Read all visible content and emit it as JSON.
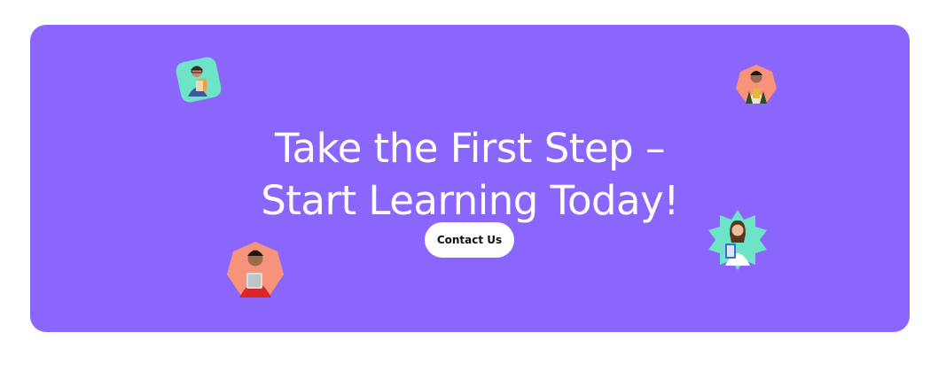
{
  "banner": {
    "headline_line1": "Take the First Step –",
    "headline_line2": "Start Learning Today!",
    "cta_label": "Contact Us"
  },
  "colors": {
    "banner_bg": "#8b66fc",
    "text": "#ffffff",
    "mint": "#6fe3c6",
    "peach": "#f7937a",
    "cta_bg": "#ffffff",
    "cta_text": "#111111"
  },
  "avatars": [
    {
      "name": "student-with-notebooks-photo",
      "shape": "rounded-square",
      "bg": "mint"
    },
    {
      "name": "student-with-backpack-photo",
      "shape": "heptagon",
      "bg": "peach"
    },
    {
      "name": "student-holding-laptop-photo",
      "shape": "heptagon",
      "bg": "peach"
    },
    {
      "name": "student-holding-folder-photo",
      "shape": "star-burst",
      "bg": "mint"
    }
  ]
}
